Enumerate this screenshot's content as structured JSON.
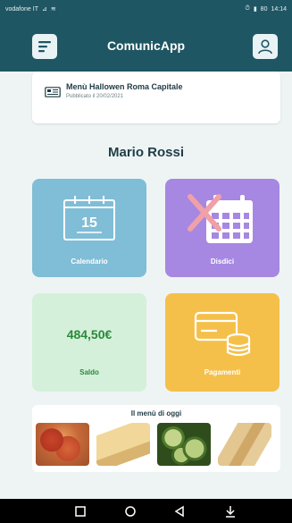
{
  "status_bar": {
    "carrier": "vodafone IT",
    "signal": "⊿",
    "wifi": "≋",
    "battery": "80",
    "time": "14:14"
  },
  "header": {
    "title": "ComunicApp",
    "menu_icon": "menu-icon",
    "user_icon": "user-icon"
  },
  "news": {
    "title": "Menù Hallowen Roma Capitale",
    "published": "Pubblicato il 20/02/2021"
  },
  "user": {
    "name": "Mario Rossi"
  },
  "tiles": {
    "calendar": {
      "label": "Calendario",
      "day": "15"
    },
    "cancel": {
      "label": "Disdici"
    },
    "balance": {
      "label": "Saldo",
      "amount": "484,50€"
    },
    "payments": {
      "label": "Pagamenti"
    }
  },
  "daily_menu": {
    "title": "Il menù di oggi"
  },
  "nav": {
    "square": "square-icon",
    "home": "circle-icon",
    "back": "back-icon",
    "notification": "download-icon"
  },
  "colors": {
    "header_bg": "#1f5663",
    "calendar": "#80bdd6",
    "cancel": "#a687e2",
    "balance": "#d4f0da",
    "payments": "#f5c04a"
  }
}
